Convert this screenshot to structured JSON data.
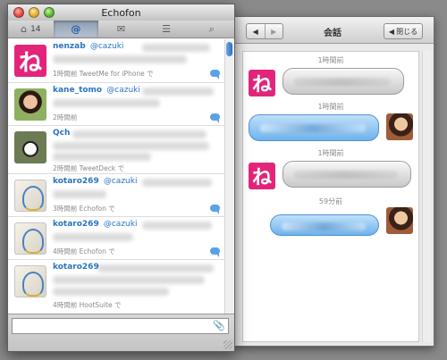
{
  "main_window": {
    "title": "Echofon",
    "toolbar": [
      {
        "label": "⌂",
        "badge": "14"
      },
      {
        "label": "@"
      },
      {
        "label": "✉"
      },
      {
        "label": "☰"
      },
      {
        "label": "⌕"
      }
    ],
    "tweets": [
      {
        "user": "nenzab",
        "mention": "@cazuki",
        "meta": "1時間前 TweetMe for iPhone で",
        "avatar": "ne-icon",
        "avatar_text": "ね"
      },
      {
        "user": "kane_tomo",
        "mention": "@cazuki",
        "meta": "2時間前",
        "avatar": "photo-avatar"
      },
      {
        "user": "Qch",
        "mention": "",
        "meta": "2時間前 TweetDeck で",
        "avatar": "panda-avatar"
      },
      {
        "user": "kotaro269",
        "mention": "@cazuki",
        "meta": "3時間前 Echofon で",
        "avatar": "illustration-avatar"
      },
      {
        "user": "kotaro269",
        "mention": "@cazuki",
        "meta": "4時間前 Echofon で",
        "avatar": "illustration-avatar"
      },
      {
        "user": "kotaro269",
        "mention": "",
        "meta": "4時間前 HootSuite で",
        "avatar": "illustration-avatar"
      }
    ],
    "compose_placeholder": "",
    "attach_icon": "📎"
  },
  "conversation_window": {
    "title": "会話",
    "prev_label": "◀",
    "next_label": "▶",
    "close_label": "閉じる",
    "close_arrow": "◀",
    "messages": [
      {
        "timestamp": "1時間前",
        "side": "left",
        "avatar_text": "ね"
      },
      {
        "timestamp": "1時間前",
        "side": "right"
      },
      {
        "timestamp": "1時間前",
        "side": "left",
        "avatar_text": "ね"
      },
      {
        "timestamp": "59分前",
        "side": "right"
      }
    ]
  },
  "colors": {
    "accent_blue": "#2a74c0",
    "ne_icon_pink": "#e2257b",
    "bubble_blue": "#6fb3ec",
    "reply_badge": "#5aa2e6"
  }
}
